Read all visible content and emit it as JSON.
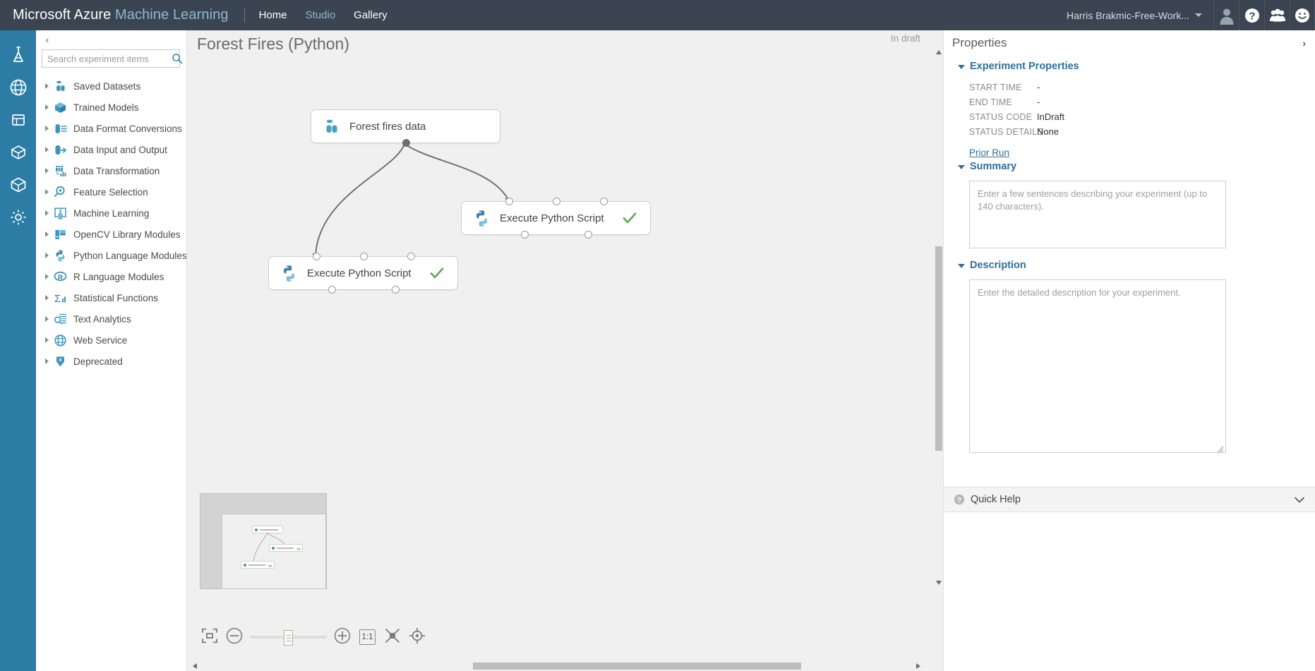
{
  "header": {
    "brand_main": "Microsoft Azure",
    "brand_sub": "Machine Learning",
    "nav": [
      {
        "label": "Home",
        "accent": false
      },
      {
        "label": "Studio",
        "accent": true
      },
      {
        "label": "Gallery",
        "accent": false
      }
    ],
    "account_name": "Harris Brakmic-Free-Work...",
    "buttons": [
      {
        "name": "avatar",
        "icon": "user-avatar-icon"
      },
      {
        "name": "help",
        "icon": "question-mark-icon"
      },
      {
        "name": "community",
        "icon": "people-group-icon"
      },
      {
        "name": "feedback",
        "icon": "smiley-face-icon"
      }
    ],
    "background": "#3b4551",
    "accent": "#8fb8d0"
  },
  "rail": {
    "background": "#2c7ca5",
    "items": [
      {
        "name": "experiments",
        "icon": "flask-icon"
      },
      {
        "name": "web-services",
        "icon": "globe-icon"
      },
      {
        "name": "datasets",
        "icon": "dataset-icon"
      },
      {
        "name": "trained-models",
        "icon": "cube-stack-icon"
      },
      {
        "name": "notebooks",
        "icon": "box-icon"
      },
      {
        "name": "settings",
        "icon": "gear-icon"
      }
    ]
  },
  "tree_panel": {
    "collapse_label": "‹",
    "search": {
      "placeholder": "Search experiment items",
      "value": "",
      "icon": "search-icon"
    },
    "items": [
      {
        "label": "Saved Datasets",
        "icon": "datasets-icon"
      },
      {
        "label": "Trained Models",
        "icon": "cube-icon"
      },
      {
        "label": "Data Format Conversions",
        "icon": "data-format-icon"
      },
      {
        "label": "Data Input and Output",
        "icon": "data-io-icon"
      },
      {
        "label": "Data Transformation",
        "icon": "data-transform-icon"
      },
      {
        "label": "Feature Selection",
        "icon": "magnifier-icon"
      },
      {
        "label": "Machine Learning",
        "icon": "flask-monitor-icon"
      },
      {
        "label": "OpenCV Library Modules",
        "icon": "opencv-icon"
      },
      {
        "label": "Python Language Modules",
        "icon": "python-icon"
      },
      {
        "label": "R Language Modules",
        "icon": "r-icon"
      },
      {
        "label": "Statistical Functions",
        "icon": "sigma-icon"
      },
      {
        "label": "Text Analytics",
        "icon": "text-analytics-icon"
      },
      {
        "label": "Web Service",
        "icon": "globe-icon"
      },
      {
        "label": "Deprecated",
        "icon": "deprecated-icon"
      }
    ]
  },
  "canvas": {
    "title": "Forest Fires (Python)",
    "status": "In draft",
    "background": "#f0f0f0",
    "nodes": [
      {
        "id": "dataset",
        "label": "Forest fires data",
        "icon": "dataset-icon",
        "checked": false
      },
      {
        "id": "python-right",
        "label": "Execute Python Script",
        "icon": "python-icon",
        "checked": true
      },
      {
        "id": "python-left",
        "label": "Execute Python Script",
        "icon": "python-icon",
        "checked": true
      }
    ],
    "zoom_toolbar": {
      "fit_selection_label": "fit-to-selection",
      "zoom_out_label": "zoom-out",
      "zoom_in_label": "zoom-in",
      "ratio_label": "1:1",
      "fit_window_label": "fit-to-window",
      "center_label": "center-graph"
    }
  },
  "properties": {
    "title": "Properties",
    "collapse_label": "›",
    "experiment_properties": {
      "section_title": "Experiment Properties",
      "rows": [
        {
          "key": "START TIME",
          "value": "-"
        },
        {
          "key": "END TIME",
          "value": "-"
        },
        {
          "key": "STATUS CODE",
          "value": "InDraft"
        },
        {
          "key": "STATUS DETAILS",
          "value": "None"
        }
      ],
      "prior_run_label": "Prior Run"
    },
    "summary": {
      "section_title": "Summary",
      "placeholder": "Enter a few sentences describing your experiment (up to 140 characters).",
      "value": ""
    },
    "description": {
      "section_title": "Description",
      "placeholder": "Enter the detailed description for your experiment.",
      "value": ""
    },
    "quick_help": {
      "label": "Quick Help",
      "icon": "question-circle-icon",
      "chevron": "⌄"
    }
  }
}
